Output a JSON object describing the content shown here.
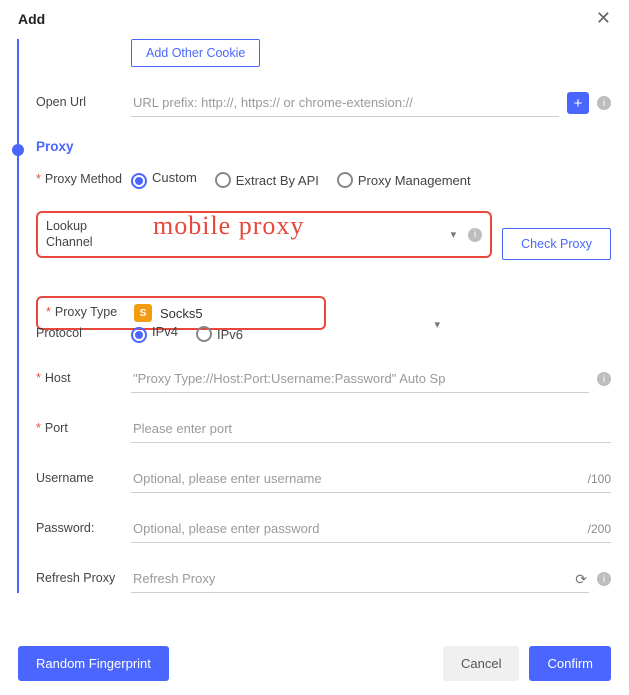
{
  "header": {
    "title": "Add"
  },
  "cookie": {
    "add_other_btn": "Add Other Cookie"
  },
  "open_url": {
    "label": "Open Url",
    "placeholder": "URL prefix: http://, https:// or chrome-extension://"
  },
  "proxy": {
    "section_title": "Proxy",
    "method_label": "Proxy Method",
    "methods": {
      "custom": "Custom",
      "api": "Extract By API",
      "mgmt": "Proxy Management"
    },
    "lookup_label": "Lookup Channel",
    "annotation_text": "mobile proxy",
    "check_btn": "Check Proxy",
    "type_label": "Proxy Type",
    "type_value": "Socks5",
    "type_badge": "S",
    "protocol_label": "Protocol",
    "protocols": {
      "v4": "IPv4",
      "v6": "IPv6"
    },
    "host_label": "Host",
    "host_placeholder": "\"Proxy Type://Host:Port:Username:Password\" Auto Sp",
    "port_label": "Port",
    "port_placeholder": "Please enter port",
    "username_label": "Username",
    "username_placeholder": "Optional, please enter username",
    "username_suffix": "/100",
    "password_label": "Password:",
    "password_placeholder": "Optional, please enter password",
    "password_suffix": "/200",
    "refresh_label": "Refresh Proxy",
    "refresh_placeholder": "Refresh Proxy"
  },
  "footer": {
    "random_fp": "Random Fingerprint",
    "cancel": "Cancel",
    "confirm": "Confirm"
  }
}
